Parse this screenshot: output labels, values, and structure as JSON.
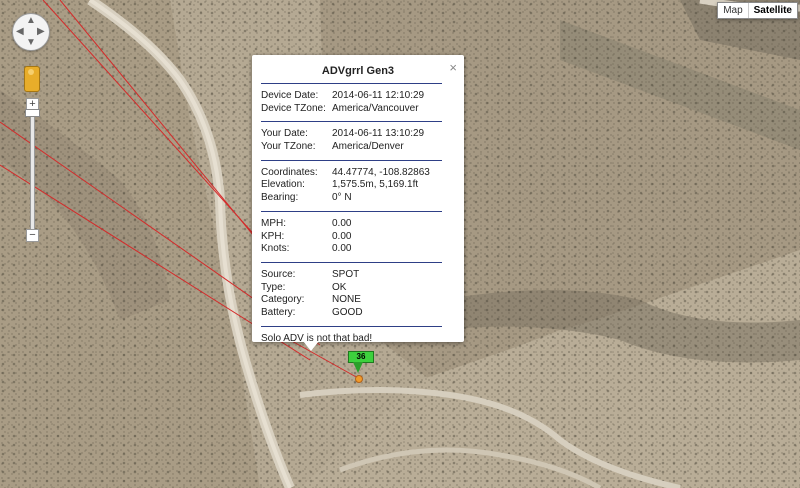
{
  "map": {
    "type_buttons": [
      "Map",
      "Satellite"
    ],
    "selected_type": "Satellite",
    "zoom_in": "+",
    "zoom_out": "−",
    "zoom_level_fraction": 0.03
  },
  "info_window": {
    "title": "ADVgrrl Gen3",
    "close": "×",
    "sections": [
      [
        {
          "label": "Device Date:",
          "value": "2014-06-11 12:10:29"
        },
        {
          "label": "Device TZone:",
          "value": "America/Vancouver"
        }
      ],
      [
        {
          "label": "Your Date:",
          "value": "2014-06-11 13:10:29"
        },
        {
          "label": "Your TZone:",
          "value": "America/Denver"
        }
      ],
      [
        {
          "label": "Coordinates:",
          "value": "44.47774, -108.82863"
        },
        {
          "label": "Elevation:",
          "value": "1,575.5m, 5,169.1ft"
        },
        {
          "label": "Bearing:",
          "value": "0° N"
        }
      ],
      [
        {
          "label": "MPH:",
          "value": "0.00"
        },
        {
          "label": "KPH:",
          "value": "0.00"
        },
        {
          "label": "Knots:",
          "value": "0.00"
        }
      ],
      [
        {
          "label": "Source:",
          "value": "SPOT"
        },
        {
          "label": "Type:",
          "value": "OK"
        },
        {
          "label": "Category:",
          "value": "NONE"
        },
        {
          "label": "Battery:",
          "value": "GOOD"
        }
      ]
    ],
    "note": "Solo ADV is not that bad!"
  },
  "marker": {
    "label": "36"
  },
  "colors": {
    "track_line": "#d42a2a",
    "rule": "#2e3f86",
    "marker_flag": "#3dd13d"
  }
}
